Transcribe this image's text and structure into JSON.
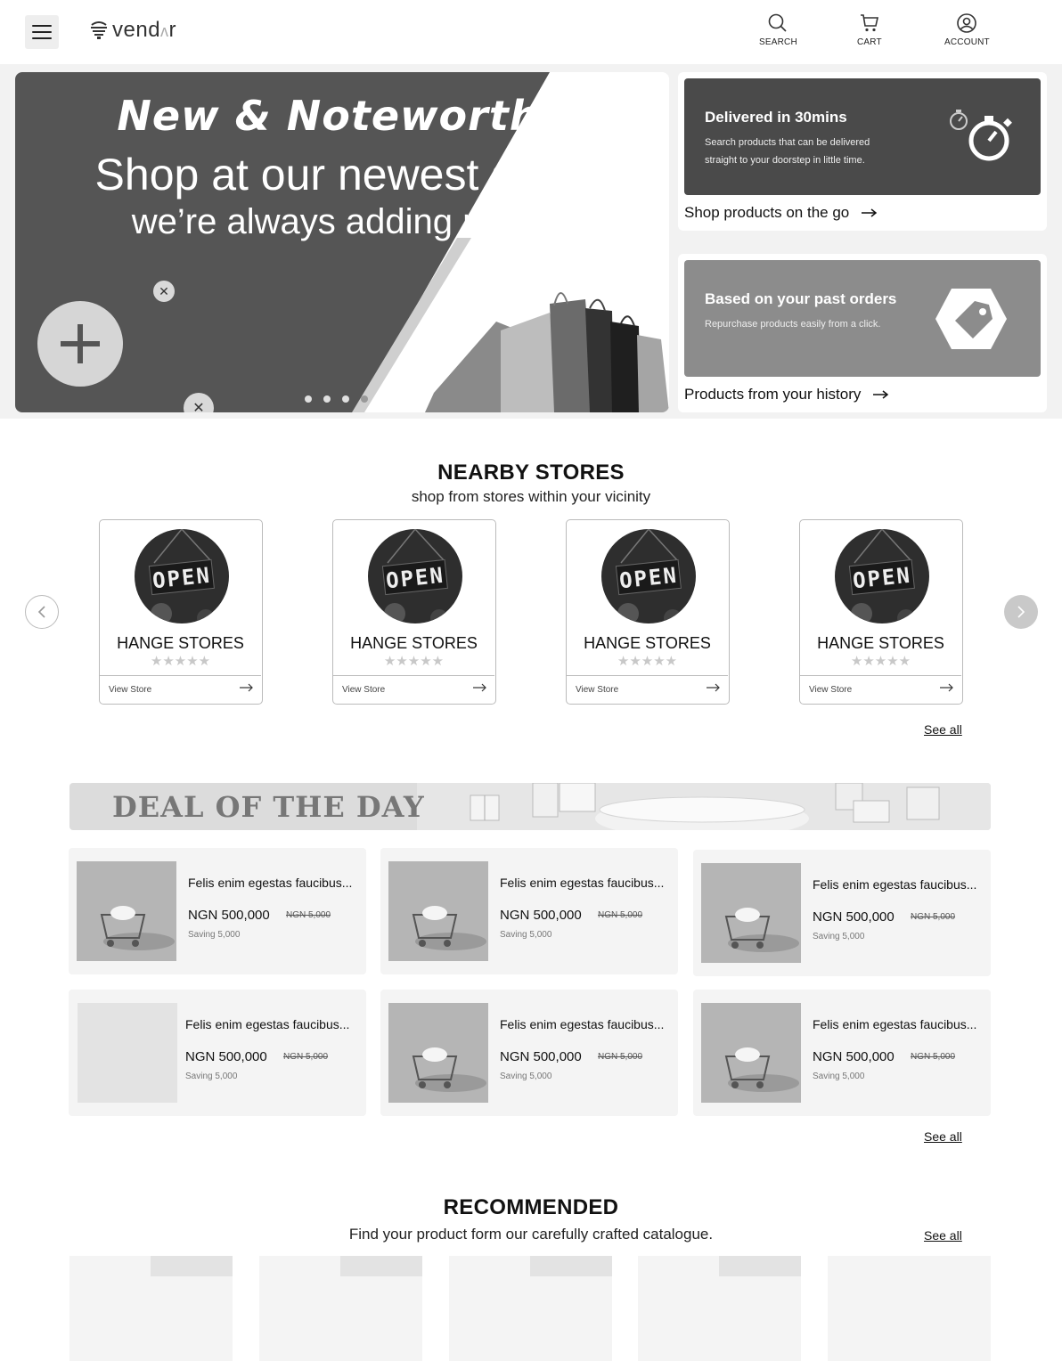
{
  "header": {
    "logo_text_pre": "vend",
    "logo_text_mid": "ʌ",
    "logo_text_post": "r",
    "nav": [
      {
        "label": "SEARCH",
        "icon": "search-icon"
      },
      {
        "label": "CART",
        "icon": "cart-icon"
      },
      {
        "label": "ACCOUNT",
        "icon": "account-icon"
      }
    ]
  },
  "hero": {
    "title": "New & Noteworthy",
    "headline": "Shop at our newest stores",
    "subline": "we’re always adding more",
    "slide_count": 4,
    "active_slide": 4
  },
  "promos": [
    {
      "title": "Delivered in 30mins",
      "description": "Search products that can be delivered straight to your doorstep in little time.",
      "link": "Shop products on the go",
      "icon": "stopwatch-icon"
    },
    {
      "title": "Based on your past orders",
      "description": "Repurchase products easily from a click.",
      "link": "Products from your history",
      "icon": "tag-icon"
    }
  ],
  "nearby": {
    "title": "NEARBY STORES",
    "subtitle": "shop from stores within your vicinity",
    "stores": [
      {
        "name": "HANGE STORES",
        "rating": 0,
        "action": "View Store",
        "sign": "OPEN"
      },
      {
        "name": "HANGE STORES",
        "rating": 0,
        "action": "View Store",
        "sign": "OPEN"
      },
      {
        "name": "HANGE STORES",
        "rating": 0,
        "action": "View Store",
        "sign": "OPEN"
      },
      {
        "name": "HANGE STORES",
        "rating": 0,
        "action": "View Store",
        "sign": "OPEN"
      }
    ],
    "see_all": "See all"
  },
  "deal": {
    "banner": "DEAL OF THE DAY",
    "items": [
      {
        "name": "Felis enim egestas faucibus...",
        "price": "NGN 500,000",
        "old_price": "NGN 5,000",
        "saving": "Saving 5,000"
      },
      {
        "name": "Felis enim egestas faucibus...",
        "price": "NGN 500,000",
        "old_price": "NGN 5,000",
        "saving": "Saving 5,000"
      },
      {
        "name": "Felis enim egestas faucibus...",
        "price": "NGN 500,000",
        "old_price": "NGN 5,000",
        "saving": "Saving 5,000"
      },
      {
        "name": "Felis enim egestas faucibus...",
        "price": "NGN 500,000",
        "old_price": "NGN 5,000",
        "saving": "Saving 5,000"
      },
      {
        "name": "Felis enim egestas faucibus...",
        "price": "NGN 500,000",
        "old_price": "NGN 5,000",
        "saving": "Saving 5,000"
      },
      {
        "name": "Felis enim egestas faucibus...",
        "price": "NGN 500,000",
        "old_price": "NGN 5,000",
        "saving": "Saving 5,000"
      }
    ],
    "see_all": "See all"
  },
  "recommended": {
    "title": "RECOMMENDED",
    "subtitle": "Find your product form our carefully crafted catalogue.",
    "see_all": "See all"
  },
  "colors": {
    "hero_dark": "#555555",
    "promo_dark": "#4a4a4a",
    "promo_mid": "#8c8c8c"
  }
}
